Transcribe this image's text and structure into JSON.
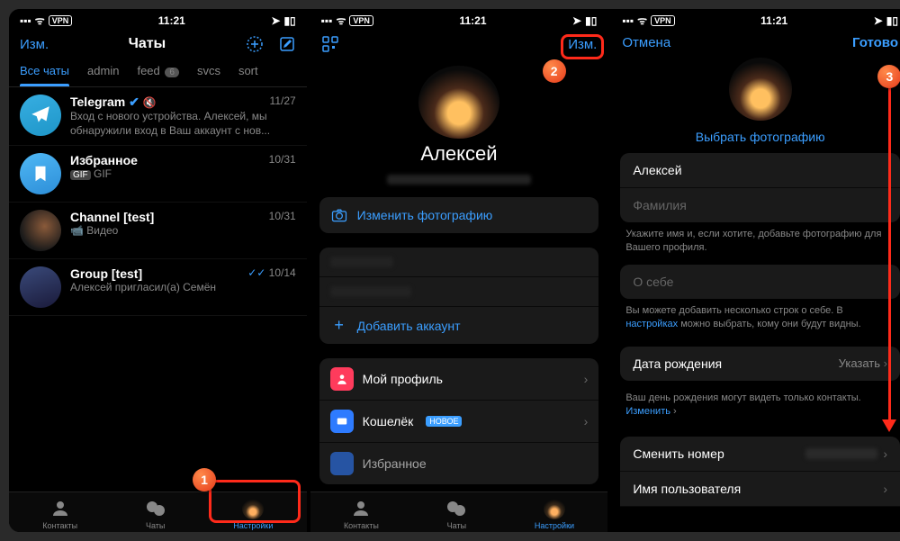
{
  "status": {
    "time": "11:21",
    "vpn": "VPN"
  },
  "pane1": {
    "edit": "Изм.",
    "title": "Чаты",
    "filters": [
      "Все чаты",
      "admin",
      "feed",
      "svcs",
      "sort"
    ],
    "feed_badge": "6",
    "chats": [
      {
        "name": "Telegram",
        "date": "11/27",
        "msg": "Вход с нового устройства. Алексей, мы обнаружили вход в Ваш аккаунт с нов..."
      },
      {
        "name": "Избранное",
        "date": "10/31",
        "msg": "GIF"
      },
      {
        "name": "Channel [test]",
        "date": "10/31",
        "msg": "Видео"
      },
      {
        "name": "Group [test]",
        "date": "10/14",
        "msg": "Алексей пригласил(а) Семён"
      }
    ],
    "tabs": {
      "contacts": "Контакты",
      "chats": "Чаты",
      "settings": "Настройки"
    }
  },
  "pane2": {
    "edit": "Изм.",
    "name": "Алексей",
    "change_photo": "Изменить фотографию",
    "add_account": "Добавить аккаунт",
    "my_profile": "Мой профиль",
    "wallet": "Кошелёк",
    "wallet_new": "НОВОЕ",
    "favorites": "Избранное"
  },
  "pane3": {
    "cancel": "Отмена",
    "done": "Готово",
    "choose_photo": "Выбрать фотографию",
    "first_name": "Алексей",
    "last_name_ph": "Фамилия",
    "name_hint": "Укажите имя и, если хотите, добавьте фотографию для Вашего профиля.",
    "about_ph": "О себе",
    "about_hint1": "Вы можете добавить несколько строк о себе. В ",
    "about_hint_link": "настройках",
    "about_hint2": " можно выбрать, кому они будут видны.",
    "birthday": "Дата рождения",
    "specify": "Указать",
    "bday_hint1": "Ваш день рождения могут видеть только контакты. ",
    "bday_hint_link": "Изменить",
    "change_number": "Сменить номер",
    "username": "Имя пользователя"
  }
}
